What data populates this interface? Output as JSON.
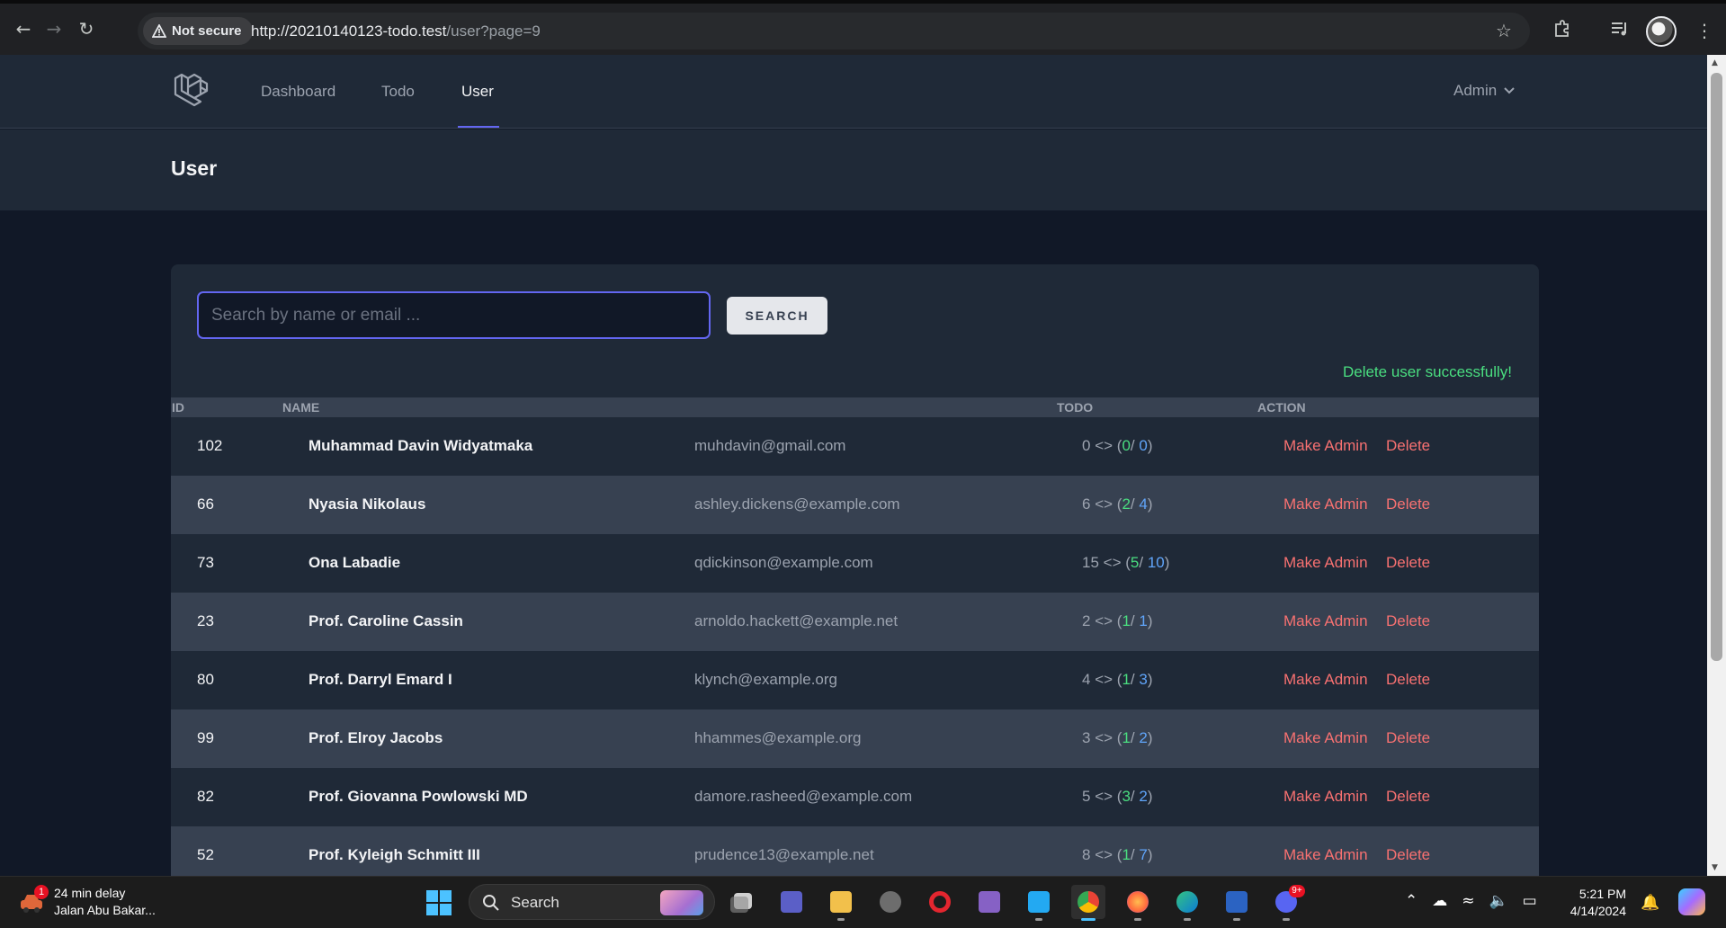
{
  "browser": {
    "security_label": "Not secure",
    "url_host": "http://20210140123-todo.test",
    "url_path": "/user?page=9"
  },
  "nav": {
    "links": [
      "Dashboard",
      "Todo",
      "User"
    ],
    "active": "User",
    "user_menu": "Admin"
  },
  "page": {
    "title": "User"
  },
  "search": {
    "placeholder": "Search by name or email ...",
    "value": "",
    "button_label": "SEARCH"
  },
  "flash_message": "Delete user successfully!",
  "table": {
    "headers": [
      "ID",
      "NAME",
      "TODO",
      "ACTION"
    ],
    "rows": [
      {
        "id": "102",
        "name": "Muhammad Davin Widyatmaka",
        "email": "muhdavin@gmail.com",
        "todo_total": "0",
        "todo_done": "0",
        "todo_pending": "0"
      },
      {
        "id": "66",
        "name": "Nyasia Nikolaus",
        "email": "ashley.dickens@example.com",
        "todo_total": "6",
        "todo_done": "2",
        "todo_pending": "4"
      },
      {
        "id": "73",
        "name": "Ona Labadie",
        "email": "qdickinson@example.com",
        "todo_total": "15",
        "todo_done": "5",
        "todo_pending": "10"
      },
      {
        "id": "23",
        "name": "Prof. Caroline Cassin",
        "email": "arnoldo.hackett@example.net",
        "todo_total": "2",
        "todo_done": "1",
        "todo_pending": "1"
      },
      {
        "id": "80",
        "name": "Prof. Darryl Emard I",
        "email": "klynch@example.org",
        "todo_total": "4",
        "todo_done": "1",
        "todo_pending": "3"
      },
      {
        "id": "99",
        "name": "Prof. Elroy Jacobs",
        "email": "hhammes@example.org",
        "todo_total": "3",
        "todo_done": "1",
        "todo_pending": "2"
      },
      {
        "id": "82",
        "name": "Prof. Giovanna Powlowski MD",
        "email": "damore.rasheed@example.com",
        "todo_total": "5",
        "todo_done": "3",
        "todo_pending": "2"
      },
      {
        "id": "52",
        "name": "Prof. Kyleigh Schmitt III",
        "email": "prudence13@example.net",
        "todo_total": "8",
        "todo_done": "1",
        "todo_pending": "7"
      }
    ],
    "action_make_admin": "Make Admin",
    "action_delete": "Delete"
  },
  "taskbar": {
    "weather_line1": "24 min delay",
    "weather_line2": "Jalan Abu Bakar...",
    "weather_badge": "1",
    "search_label": "Search",
    "discord_badge": "9+",
    "time": "5:21 PM",
    "date": "4/14/2024"
  },
  "colors": {
    "accent": "#6366f1",
    "danger": "#f87171",
    "success": "#4ade80",
    "info": "#60a5fa"
  }
}
